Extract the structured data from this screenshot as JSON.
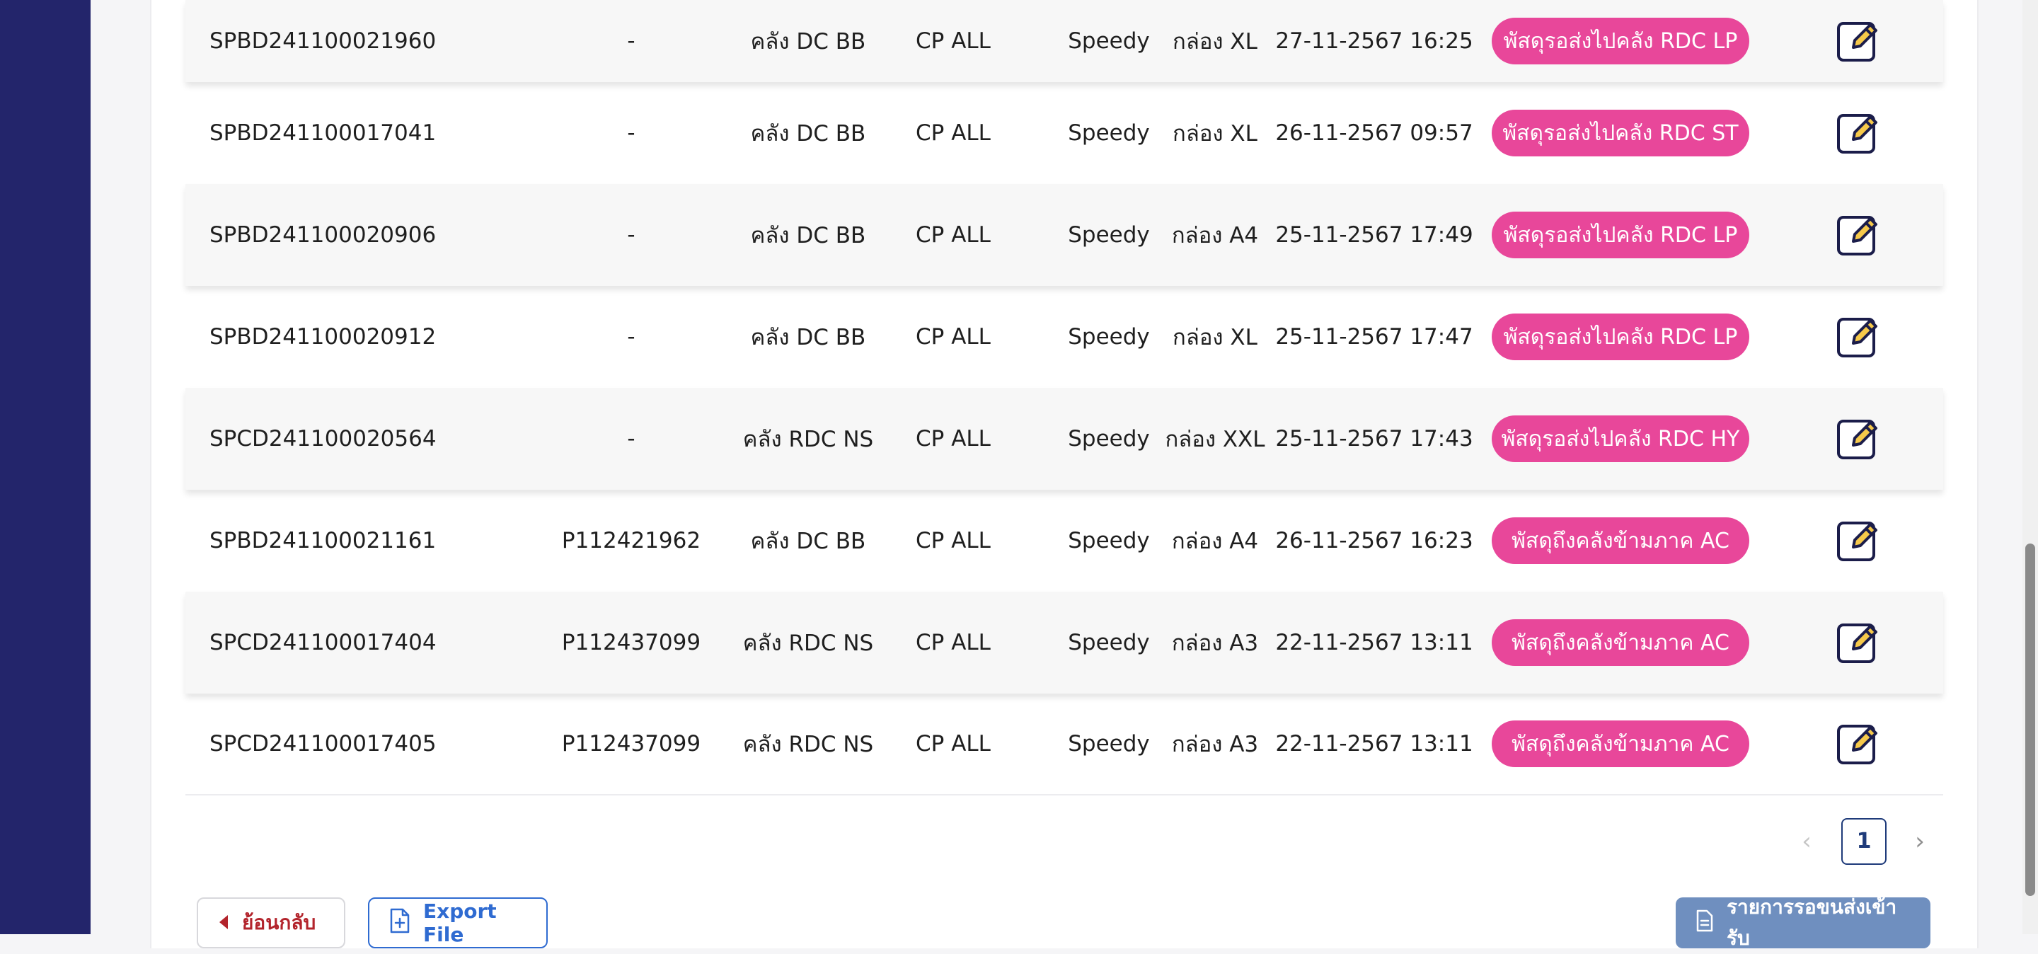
{
  "colors": {
    "sidebar": "#23256b",
    "badge": "#e8479a",
    "pager_active": "#1f3b7a",
    "back_button_text": "#b3242c",
    "export_button": "#2f6bd1",
    "list_button": "#6f8fbf"
  },
  "rows": [
    {
      "code": "SPBD241100021960",
      "ref": "-",
      "warehouse": "คลัง DC BB",
      "customer": "CP ALL",
      "carrier": "Speedy",
      "box": "กล่อง XL",
      "datetime": "27-11-2567 16:25",
      "status": "พัสดุรอส่งไปคลัง RDC LP"
    },
    {
      "code": "SPBD241100017041",
      "ref": "-",
      "warehouse": "คลัง DC BB",
      "customer": "CP ALL",
      "carrier": "Speedy",
      "box": "กล่อง XL",
      "datetime": "26-11-2567 09:57",
      "status": "พัสดุรอส่งไปคลัง RDC ST"
    },
    {
      "code": "SPBD241100020906",
      "ref": "-",
      "warehouse": "คลัง DC BB",
      "customer": "CP ALL",
      "carrier": "Speedy",
      "box": "กล่อง A4",
      "datetime": "25-11-2567 17:49",
      "status": "พัสดุรอส่งไปคลัง RDC LP"
    },
    {
      "code": "SPBD241100020912",
      "ref": "-",
      "warehouse": "คลัง DC BB",
      "customer": "CP ALL",
      "carrier": "Speedy",
      "box": "กล่อง XL",
      "datetime": "25-11-2567 17:47",
      "status": "พัสดุรอส่งไปคลัง RDC LP"
    },
    {
      "code": "SPCD241100020564",
      "ref": "-",
      "warehouse": "คลัง RDC NS",
      "customer": "CP ALL",
      "carrier": "Speedy",
      "box": "กล่อง XXL",
      "datetime": "25-11-2567 17:43",
      "status": "พัสดุรอส่งไปคลัง RDC HY"
    },
    {
      "code": "SPBD241100021161",
      "ref": "P112421962",
      "warehouse": "คลัง DC BB",
      "customer": "CP ALL",
      "carrier": "Speedy",
      "box": "กล่อง A4",
      "datetime": "26-11-2567 16:23",
      "status": "พัสดุถึงคลังข้ามภาค AC"
    },
    {
      "code": "SPCD241100017404",
      "ref": "P112437099",
      "warehouse": "คลัง RDC NS",
      "customer": "CP ALL",
      "carrier": "Speedy",
      "box": "กล่อง A3",
      "datetime": "22-11-2567 13:11",
      "status": "พัสดุถึงคลังข้ามภาค AC"
    },
    {
      "code": "SPCD241100017405",
      "ref": "P112437099",
      "warehouse": "คลัง RDC NS",
      "customer": "CP ALL",
      "carrier": "Speedy",
      "box": "กล่อง A3",
      "datetime": "22-11-2567 13:11",
      "status": "พัสดุถึงคลังข้ามภาค AC"
    }
  ],
  "pagination": {
    "prev": "‹",
    "current": "1",
    "next": "›"
  },
  "buttons": {
    "back": "ย้อนกลับ",
    "export": "Export File",
    "pending_list": "รายการรอขนส่งเข้ารับ"
  },
  "icons": {
    "edit": "edit-icon",
    "back": "caret-left-icon",
    "export": "file-add-icon",
    "list": "document-icon"
  }
}
